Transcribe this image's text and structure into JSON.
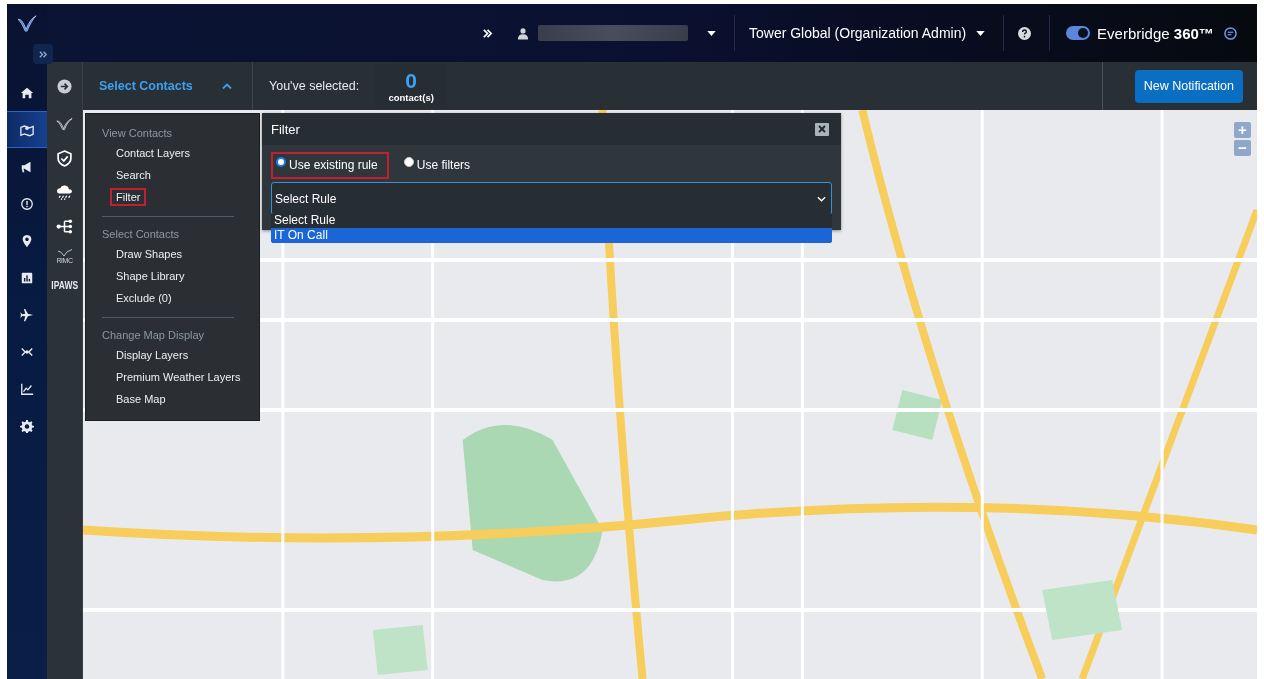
{
  "nav_rail": {
    "items": [
      {
        "selected": false
      },
      {
        "selected": true
      },
      {
        "selected": false
      },
      {
        "selected": false
      },
      {
        "selected": false
      },
      {
        "selected": false
      },
      {
        "selected": false
      },
      {
        "selected": false
      },
      {
        "selected": false
      },
      {
        "selected": false
      }
    ]
  },
  "tool_rail": {
    "items": [
      {
        "kind": "icon"
      },
      {
        "kind": "icon"
      },
      {
        "kind": "icon"
      },
      {
        "kind": "icon"
      },
      {
        "kind": "logo",
        "label": "RIMC"
      },
      {
        "kind": "text",
        "label": "IPAWS"
      }
    ]
  },
  "top_bar": {
    "organization": "Tower Global (Organization Admin)",
    "toggle": {
      "on": true
    },
    "brand": "Everbridge **360™**"
  },
  "toolbar": {
    "panel_title": "Select Contacts",
    "expanded": true,
    "selected_label": "You've selected:",
    "count": "0",
    "count_unit": "contact(s)",
    "button": "New Notification"
  },
  "menu": {
    "sections": [
      {
        "heading": "View Contacts",
        "items": [
          {
            "label": "Contact Layers",
            "highlighted": false
          },
          {
            "label": "Search",
            "highlighted": false
          },
          {
            "label": "Filter",
            "highlighted": true
          }
        ]
      },
      {
        "heading": "Select Contacts",
        "items": [
          {
            "label": "Draw Shapes",
            "highlighted": false
          },
          {
            "label": "Shape Library",
            "highlighted": false
          },
          {
            "label": "Exclude (0)",
            "highlighted": false
          }
        ]
      },
      {
        "heading": "Change Map Display",
        "items": [
          {
            "label": "Display Layers",
            "highlighted": false
          },
          {
            "label": "Premium Weather Layers",
            "highlighted": false
          },
          {
            "label": "Base Map",
            "highlighted": false
          }
        ]
      }
    ]
  },
  "filter_dialog": {
    "title": "Filter",
    "options": [
      {
        "label": "Use existing rule",
        "selected": true,
        "highlighted": true
      },
      {
        "label": "Use filters",
        "selected": false,
        "highlighted": false
      }
    ],
    "select": {
      "value": "Select Rule",
      "options": [
        {
          "label": "Select Rule",
          "highlighted": false
        },
        {
          "label": "IT On Call",
          "highlighted": true
        }
      ]
    }
  },
  "map": {
    "kind": "picture",
    "controls": [
      "+",
      "−"
    ]
  }
}
